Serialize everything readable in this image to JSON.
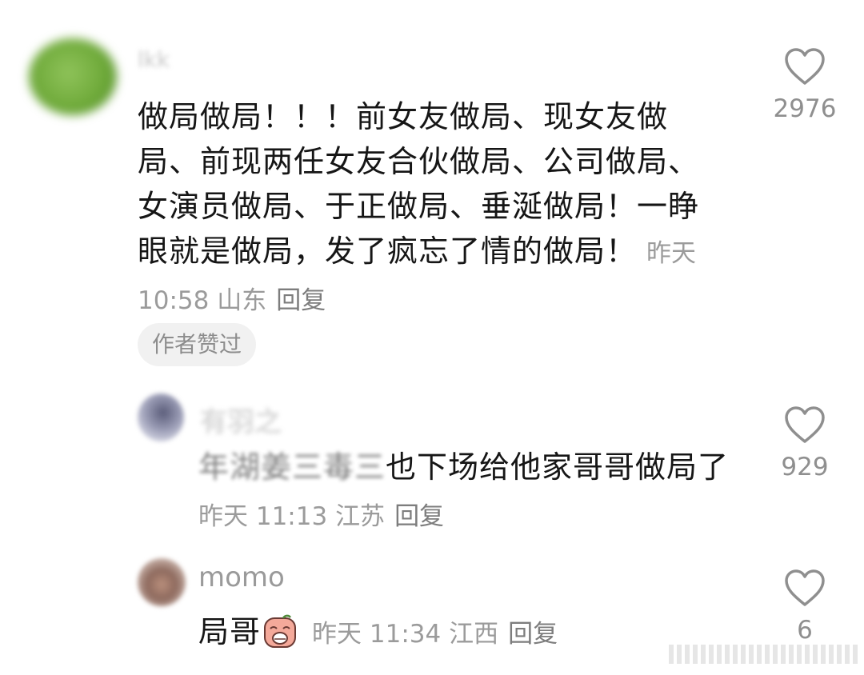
{
  "comment": {
    "author": "lkk",
    "text": "做局做局！！！前女友做局、现女友做局、前现两任女友合伙做局、公司做局、女演员做局、于正做局、垂涎做局！一睁眼就是做局，发了疯忘了情的做局！",
    "time": "昨天 10:58",
    "location": "山东",
    "reply_label": "回复",
    "badge": "作者赞过",
    "likes": "2976"
  },
  "replies": [
    {
      "author": "有羽之",
      "text_blurred": "年湖姜三毒三",
      "text": "也下场给他家哥哥做局了",
      "time": "昨天 11:13",
      "location": "江苏",
      "reply_label": "回复",
      "likes": "929"
    },
    {
      "author": "momo",
      "text": "局哥",
      "emoji": "crying-face-emoji",
      "time": "昨天 11:34",
      "location": "江西",
      "reply_label": "回复",
      "likes": "6"
    }
  ],
  "colors": {
    "text": "#161616",
    "meta": "#9b9b9b",
    "badge_bg": "#f1f1f1",
    "heart": "#8f8f8f"
  },
  "icons": {
    "like": "heart-outline-icon"
  }
}
